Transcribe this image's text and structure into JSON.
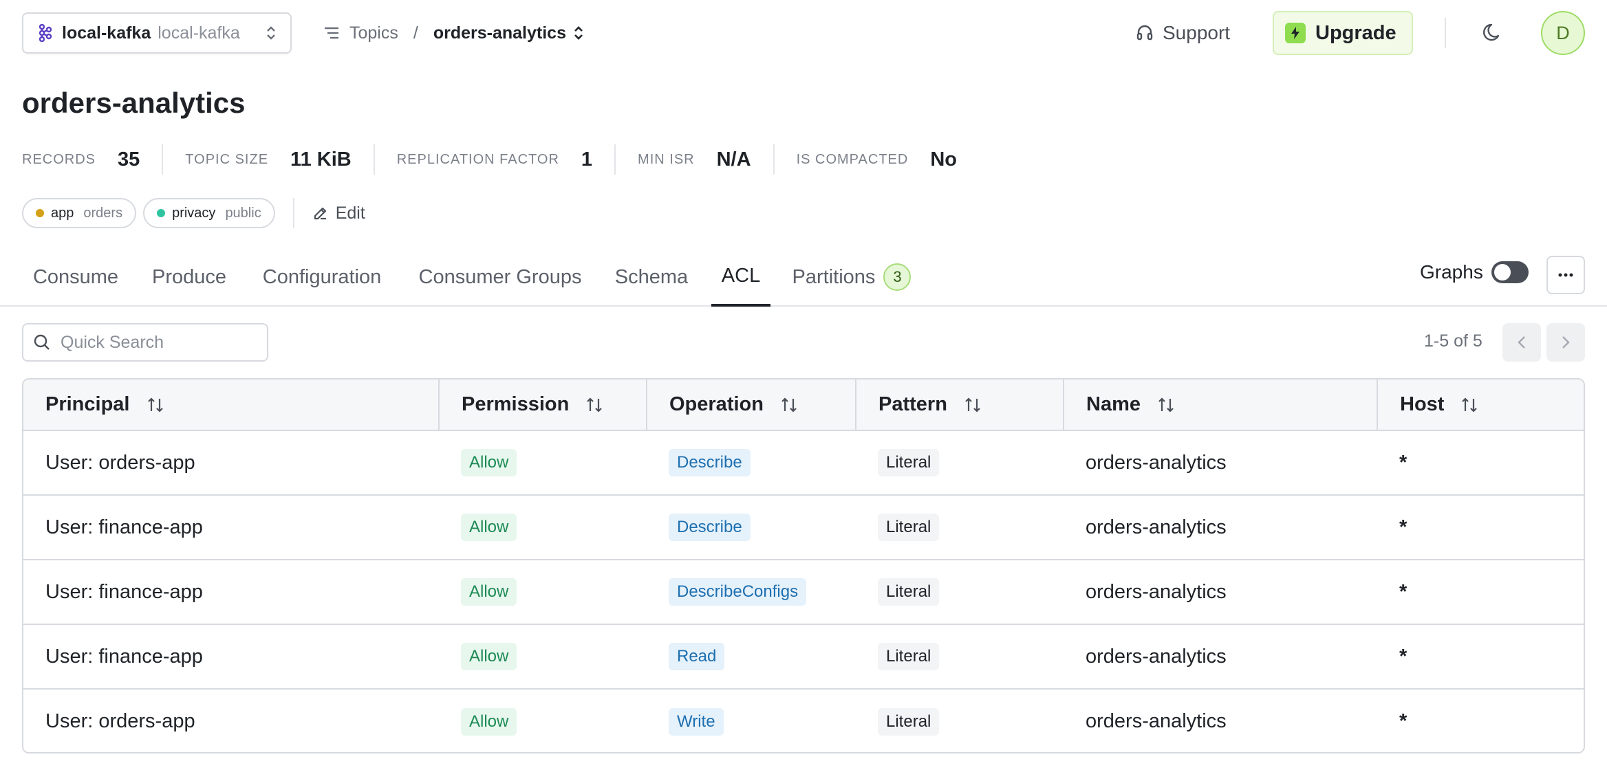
{
  "header": {
    "cluster_name": "local-kafka",
    "cluster_sub": "local-kafka",
    "breadcrumb_topics": "Topics",
    "breadcrumb_sep": "/",
    "breadcrumb_current": "orders-analytics",
    "support_label": "Support",
    "upgrade_label": "Upgrade",
    "avatar_initial": "D"
  },
  "page": {
    "title": "orders-analytics",
    "stats": [
      {
        "label": "Records",
        "value": "35"
      },
      {
        "label": "Topic Size",
        "value": "11 KiB"
      },
      {
        "label": "Replication Factor",
        "value": "1"
      },
      {
        "label": "Min ISR",
        "value": "N/A"
      },
      {
        "label": "Is Compacted",
        "value": "No"
      }
    ],
    "tags": [
      {
        "key": "app",
        "value": "orders",
        "color": "#d4a017"
      },
      {
        "key": "privacy",
        "value": "public",
        "color": "#2ec4a0"
      }
    ],
    "edit_label": "Edit"
  },
  "tabs": {
    "items": [
      "Consume",
      "Produce",
      "Configuration",
      "Consumer Groups",
      "Schema",
      "ACL",
      "Partitions"
    ],
    "active": "ACL",
    "partitions_count": "3",
    "graphs_label": "Graphs"
  },
  "search": {
    "placeholder": "Quick Search"
  },
  "pagination": {
    "info": "1-5 of 5"
  },
  "table": {
    "headers": [
      "Principal",
      "Permission",
      "Operation",
      "Pattern",
      "Name",
      "Host"
    ],
    "rows": [
      {
        "principal": "User: orders-app",
        "permission": "Allow",
        "operation": "Describe",
        "pattern": "Literal",
        "name": "orders-analytics",
        "host": "*"
      },
      {
        "principal": "User: finance-app",
        "permission": "Allow",
        "operation": "Describe",
        "pattern": "Literal",
        "name": "orders-analytics",
        "host": "*"
      },
      {
        "principal": "User: finance-app",
        "permission": "Allow",
        "operation": "DescribeConfigs",
        "pattern": "Literal",
        "name": "orders-analytics",
        "host": "*"
      },
      {
        "principal": "User: finance-app",
        "permission": "Allow",
        "operation": "Read",
        "pattern": "Literal",
        "name": "orders-analytics",
        "host": "*"
      },
      {
        "principal": "User: orders-app",
        "permission": "Allow",
        "operation": "Write",
        "pattern": "Literal",
        "name": "orders-analytics",
        "host": "*"
      }
    ]
  },
  "colors": {
    "accent_green": "#8fdc4f",
    "allow_text": "#1d8a54",
    "operation_text": "#1d6fb0"
  }
}
